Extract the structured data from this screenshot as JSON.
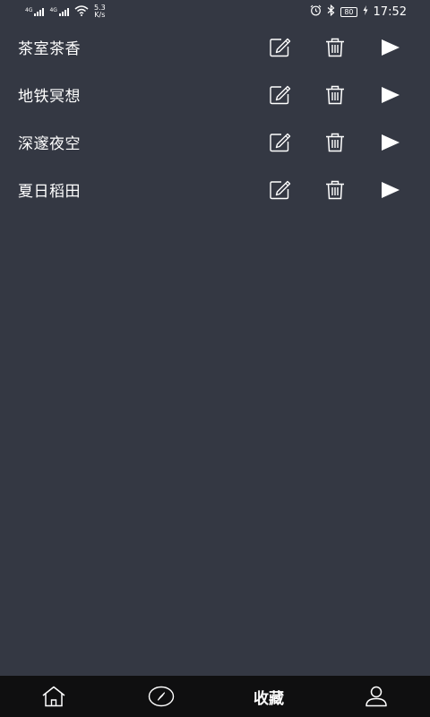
{
  "status_bar": {
    "sim1_label": "4G",
    "sim2_label": "4G",
    "speed_value": "5.3",
    "speed_unit": "K/s",
    "battery": "80",
    "time": "17:52",
    "icons": [
      "signal-icon",
      "wifi-icon",
      "alarm-icon",
      "bluetooth-icon",
      "battery-icon",
      "charging-icon"
    ]
  },
  "tracks": [
    {
      "name": "茶室茶香"
    },
    {
      "name": "地铁冥想"
    },
    {
      "name": "深邃夜空"
    },
    {
      "name": "夏日稻田"
    }
  ],
  "row_actions": {
    "edit_icon": "edit-icon",
    "delete_icon": "trash-icon",
    "play_icon": "play-icon"
  },
  "bottom_nav": {
    "items": [
      {
        "icon": "home-icon",
        "label": ""
      },
      {
        "icon": "compass-icon",
        "label": ""
      },
      {
        "icon": "",
        "label": "收藏"
      },
      {
        "icon": "user-icon",
        "label": ""
      }
    ],
    "active_index": 2
  },
  "colors": {
    "background": "#343843",
    "nav_background": "#0f0f10",
    "foreground": "#ffffff"
  }
}
